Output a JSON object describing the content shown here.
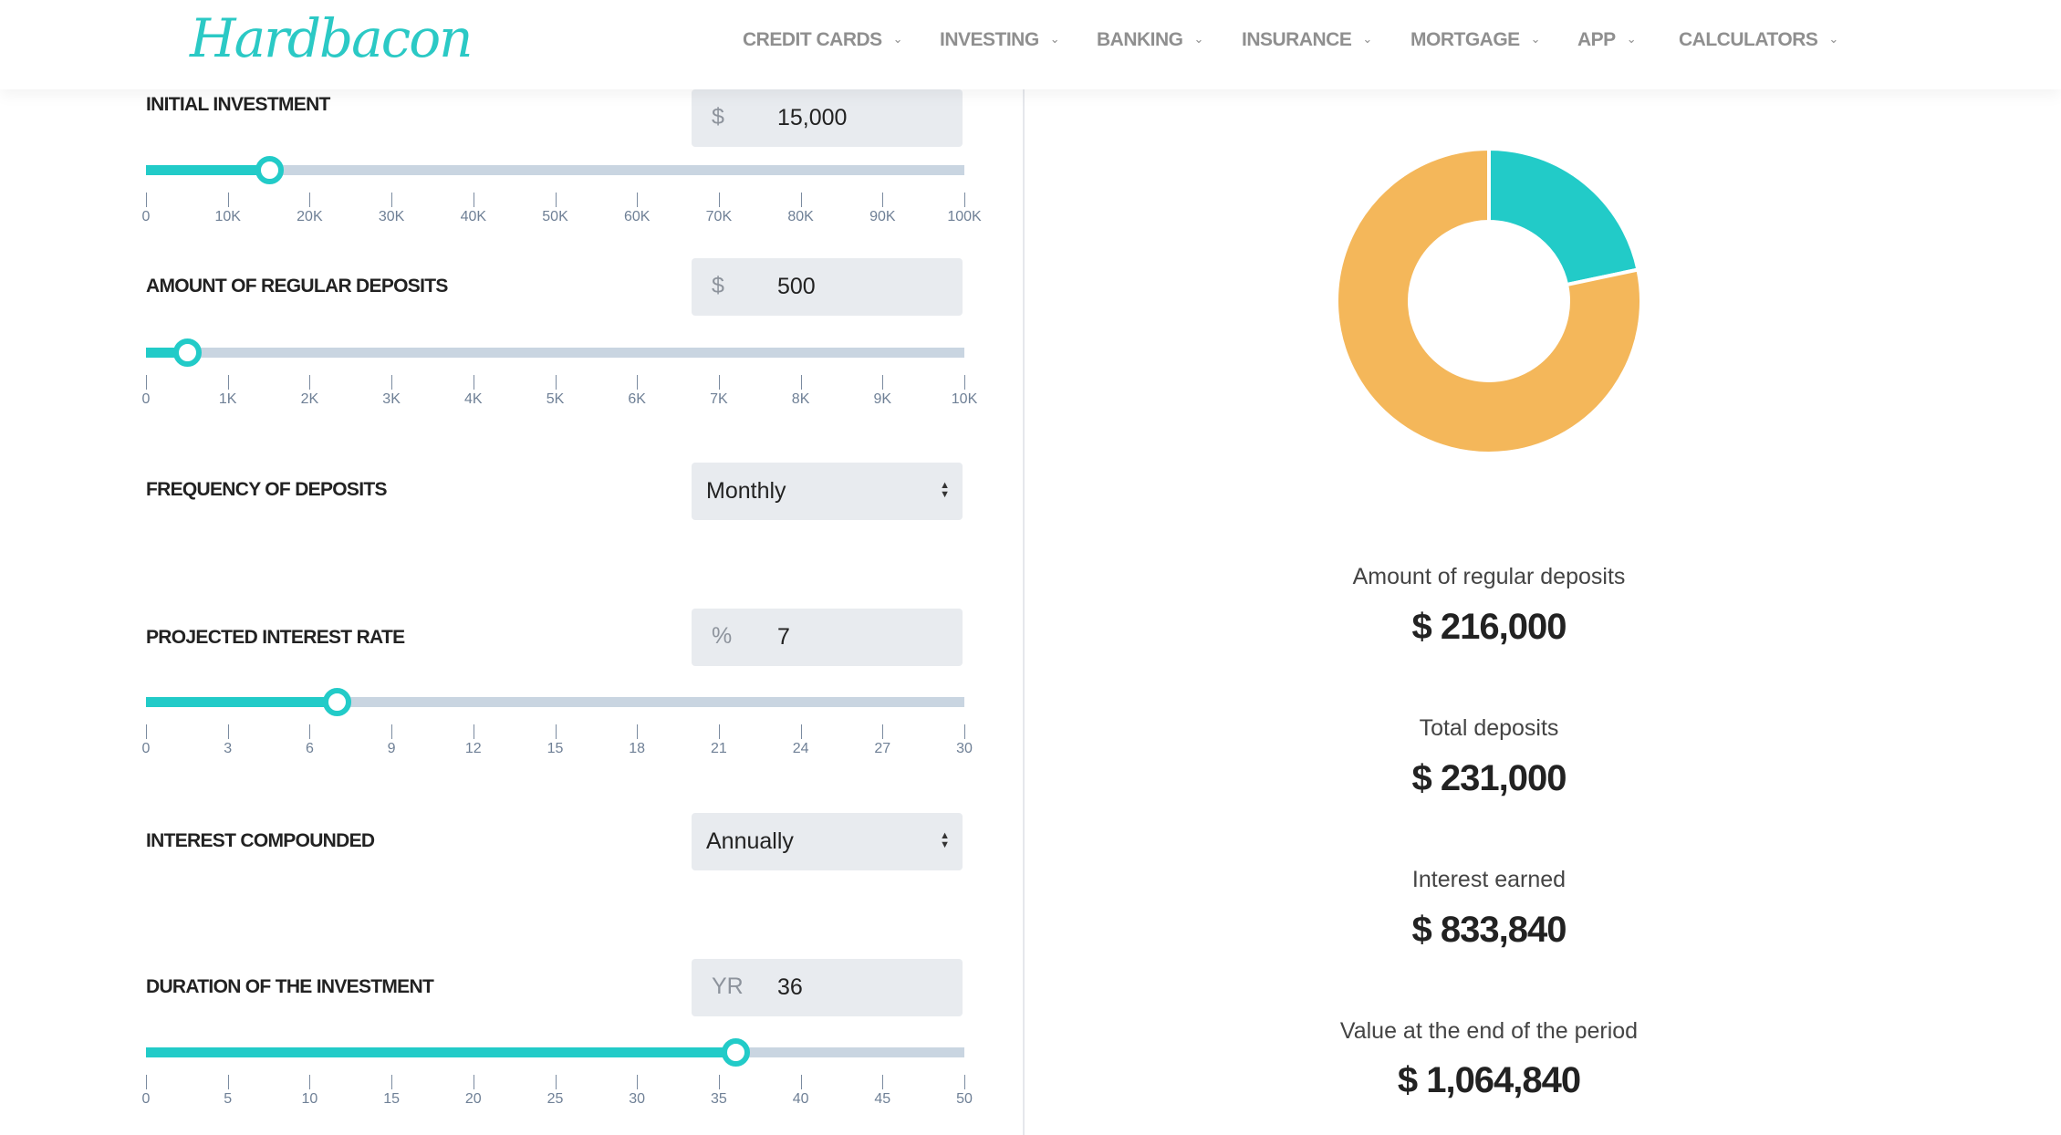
{
  "header": {
    "logo": "Hardbacon",
    "nav": [
      "CREDIT CARDS",
      "INVESTING",
      "BANKING",
      "INSURANCE",
      "MORTGAGE",
      "APP",
      "CALCULATORS"
    ]
  },
  "form": {
    "initial": {
      "label": "INITIAL INVESTMENT",
      "prefix": "$",
      "value": "15,000",
      "slider_fraction": 0.15,
      "ticks": [
        "0",
        "10K",
        "20K",
        "30K",
        "40K",
        "50K",
        "60K",
        "70K",
        "80K",
        "90K",
        "100K"
      ]
    },
    "deposits": {
      "label": "AMOUNT OF REGULAR DEPOSITS",
      "prefix": "$",
      "value": "500",
      "slider_fraction": 0.05,
      "ticks": [
        "0",
        "1K",
        "2K",
        "3K",
        "4K",
        "5K",
        "6K",
        "7K",
        "8K",
        "9K",
        "10K"
      ]
    },
    "frequency": {
      "label": "FREQUENCY OF DEPOSITS",
      "value": "Monthly"
    },
    "rate": {
      "label": "PROJECTED INTEREST RATE",
      "prefix": "%",
      "value": "7",
      "slider_fraction": 0.2333,
      "ticks": [
        "0",
        "3",
        "6",
        "9",
        "12",
        "15",
        "18",
        "21",
        "24",
        "27",
        "30"
      ]
    },
    "compound": {
      "label": "INTEREST COMPOUNDED",
      "value": "Annually"
    },
    "duration": {
      "label": "DURATION OF THE INVESTMENT",
      "prefix": "YR",
      "value": "36",
      "slider_fraction": 0.72,
      "ticks": [
        "0",
        "5",
        "10",
        "15",
        "20",
        "25",
        "30",
        "35",
        "40",
        "45",
        "50"
      ]
    }
  },
  "results": [
    {
      "label": "Amount of regular deposits",
      "value": "$ 216,000"
    },
    {
      "label": "Total deposits",
      "value": "$ 231,000"
    },
    {
      "label": "Interest earned",
      "value": "$ 833,840"
    },
    {
      "label": "Value at the end of the period",
      "value": "$ 1,064,840"
    }
  ],
  "donut": {
    "slices": [
      {
        "value": 231000,
        "color": "#22cbc8"
      },
      {
        "value": 833840,
        "color": "#f4b75a"
      }
    ]
  },
  "colors": {
    "accent": "#22cbc8",
    "orange": "#f4b75a"
  }
}
